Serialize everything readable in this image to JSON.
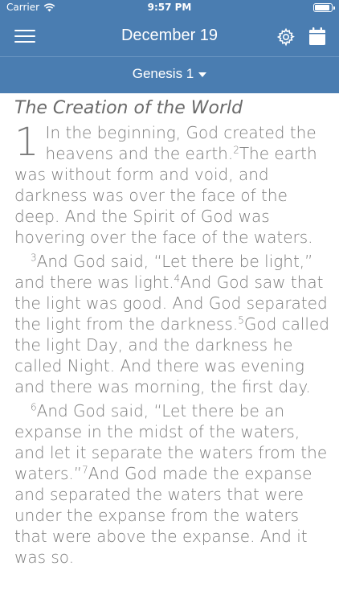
{
  "status_bar": {
    "carrier": "Carrier",
    "time": "9:57 PM"
  },
  "navbar": {
    "title": "December 19",
    "icons": [
      "menu-icon",
      "gear-icon",
      "calendar-icon"
    ]
  },
  "chapter_selector": {
    "label": "Genesis 1"
  },
  "reading": {
    "heading": "The Creation of the World",
    "chapter_number": "1",
    "paragraphs": [
      [
        {
          "v": "",
          "t": "In the beginning, God created the heavens and the earth."
        },
        {
          "v": "2",
          "t": "The earth was without form and void, and darkness was over the face of the deep. And the Spirit of God was hovering over the face of the waters."
        }
      ],
      [
        {
          "v": "3",
          "t": "And God said, “Let there be light,” and there was light."
        },
        {
          "v": "4",
          "t": "And God saw that the light was good. And God separated the light from the darkness."
        },
        {
          "v": "5",
          "t": "God called the light Day, and the darkness he called Night. And there was evening and there was morning, the first day."
        }
      ],
      [
        {
          "v": "6",
          "t": "And God said, “Let there be an expanse in the midst of the waters, and let it separate the waters from the waters.”"
        },
        {
          "v": "7",
          "t": "And God made the expanse and separated the waters that were under the expanse from the waters that were above the expanse. And it was so."
        }
      ]
    ]
  },
  "colors": {
    "bar": "#4a7db1",
    "text": "#7b7b7b"
  }
}
